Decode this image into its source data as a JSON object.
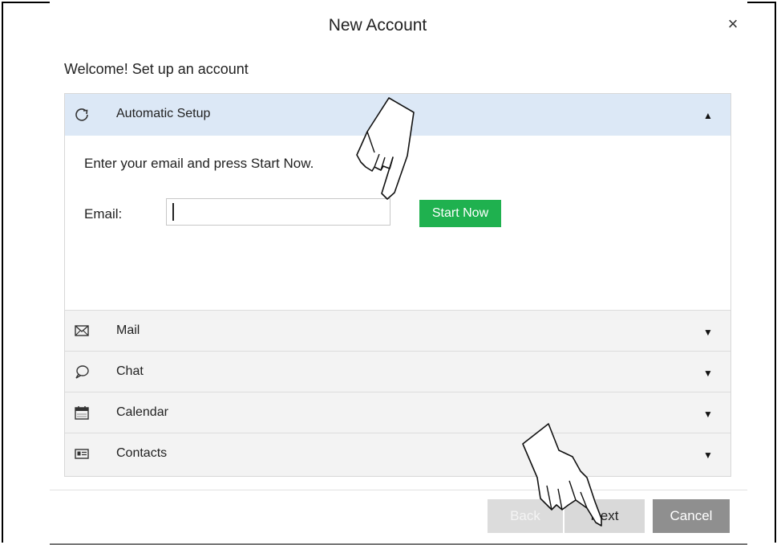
{
  "dialog": {
    "title": "New Account",
    "close_label": "×",
    "welcome": "Welcome! Set up an account"
  },
  "automatic": {
    "label": "Automatic Setup",
    "prompt": "Enter your email and press Start Now.",
    "email_label": "Email:",
    "email_value": "",
    "start_label": "Start Now"
  },
  "sections": {
    "mail": "Mail",
    "chat": "Chat",
    "calendar": "Calendar",
    "contacts": "Contacts"
  },
  "footer": {
    "back_label": "Back",
    "next_label": "Next",
    "cancel_label": "Cancel"
  },
  "icons": {
    "automatic": "refresh-icon",
    "mail": "envelope-icon",
    "chat": "speech-bubble-icon",
    "calendar": "calendar-icon",
    "contacts": "contact-card-icon",
    "expanded": "caret-up-icon",
    "collapsed": "caret-down-icon"
  },
  "colors": {
    "accent_green": "#1fb14f",
    "header_blue": "#dce8f6",
    "cancel_gray": "#8f8f8f"
  }
}
